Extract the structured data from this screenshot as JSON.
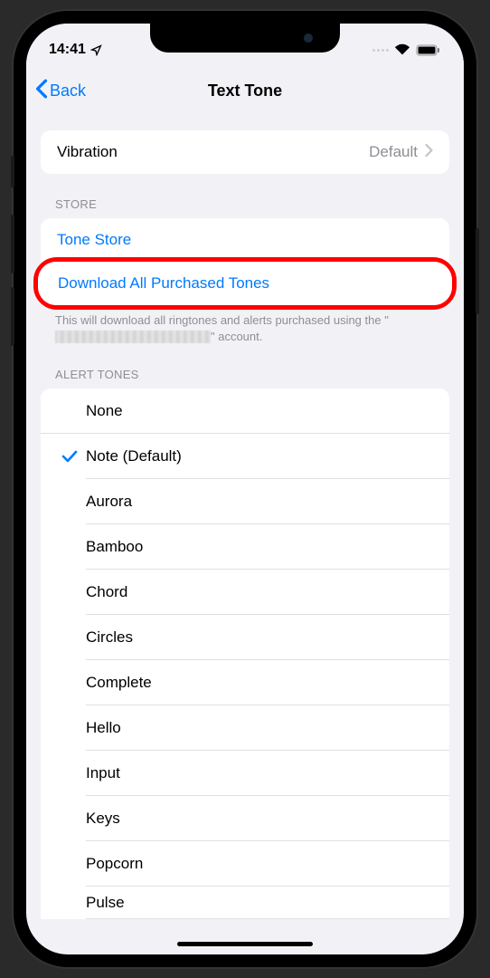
{
  "status": {
    "time": "14:41"
  },
  "nav": {
    "back_label": "Back",
    "title": "Text Tone"
  },
  "vibration": {
    "label": "Vibration",
    "value": "Default"
  },
  "store": {
    "header": "Store",
    "tone_store": "Tone Store",
    "download_all": "Download All Purchased Tones",
    "footer_pre": "This will download all ringtones and alerts purchased using the \"",
    "footer_post": "\" account."
  },
  "alert_tones": {
    "header": "Alert Tones",
    "items": [
      {
        "label": "None",
        "checked": false
      },
      {
        "label": "Note (Default)",
        "checked": true
      },
      {
        "label": "Aurora",
        "checked": false
      },
      {
        "label": "Bamboo",
        "checked": false
      },
      {
        "label": "Chord",
        "checked": false
      },
      {
        "label": "Circles",
        "checked": false
      },
      {
        "label": "Complete",
        "checked": false
      },
      {
        "label": "Hello",
        "checked": false
      },
      {
        "label": "Input",
        "checked": false
      },
      {
        "label": "Keys",
        "checked": false
      },
      {
        "label": "Popcorn",
        "checked": false
      },
      {
        "label": "Pulse",
        "checked": false
      }
    ]
  }
}
